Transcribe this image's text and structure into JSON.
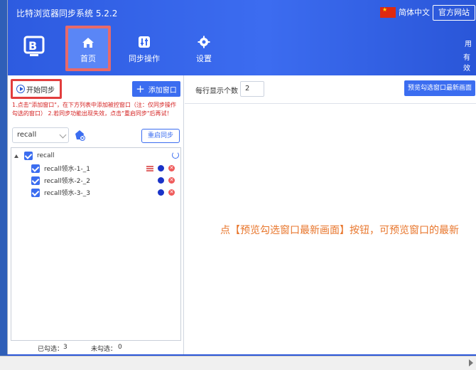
{
  "app": {
    "title": "比特浏览器同步系统 5.2.2",
    "language": "简体中文",
    "website_button": "官方网站",
    "top_right_line1": "用",
    "top_right_line2": "有效"
  },
  "nav": {
    "items": [
      {
        "label": "首页",
        "icon": "home-icon",
        "active": true
      },
      {
        "label": "同步操作",
        "icon": "sliders-icon",
        "active": false
      },
      {
        "label": "设置",
        "icon": "gear-icon",
        "active": false
      }
    ]
  },
  "left": {
    "start_sync_label": "开始同步",
    "add_window_label": "添加窗口",
    "tip": "1.点击\"添加窗口\"，在下方列表中添加被控窗口（注：仅同步操作勾选的窗口） 2.若同步功能出现失效，点击\"重启同步\"后再试！",
    "select_value": "recall",
    "restart_label": "重启同步",
    "tree": {
      "root": {
        "label": "recall",
        "checked": true
      },
      "children": [
        {
          "label": "recall领水-1-_1",
          "checked": true,
          "has_settings": true
        },
        {
          "label": "recall领水-2-_2",
          "checked": true,
          "has_settings": false
        },
        {
          "label": "recall领水-3-_3",
          "checked": true,
          "has_settings": false
        }
      ]
    },
    "footer": {
      "checked_label": "已勾选：",
      "checked_count": "3",
      "unchecked_label": "未勾选：",
      "unchecked_count": "0"
    }
  },
  "right": {
    "per_row_label": "每行显示个数",
    "per_row_value": "2",
    "preview_button": "预览勾选窗口最新画面",
    "hint": "点【预览勾选窗口最新画面】按钮，可预览窗口的最新"
  },
  "colors": {
    "header_blue": "#3c6cf0",
    "accent_blue": "#3b6df0",
    "highlight_red": "#e23d3d",
    "hint_orange": "#e8762c",
    "tip_red": "#d42020"
  }
}
